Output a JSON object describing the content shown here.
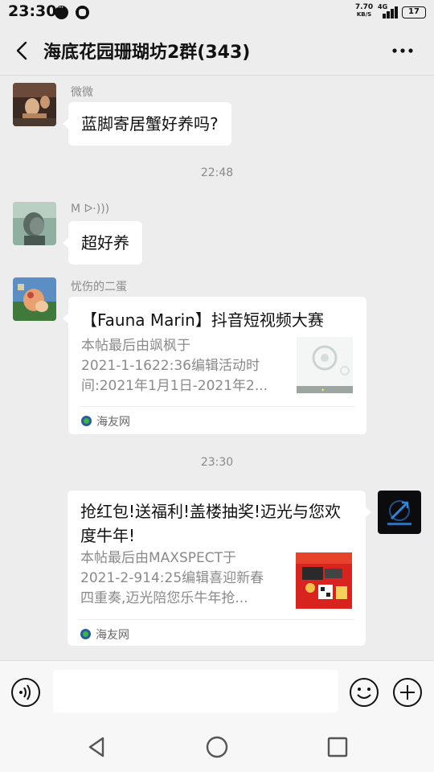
{
  "status_bar": {
    "time": "23:30",
    "net_speed_value": "7.70",
    "net_speed_unit": "KB/S",
    "network_type": "4G",
    "battery": "17"
  },
  "header": {
    "title": "海底花园珊瑚坊2群(343)",
    "back_icon": "chevron-left-icon",
    "more_icon": "more-dots-icon"
  },
  "messages": [
    {
      "type": "text",
      "side": "left",
      "sender": "微微",
      "text": "蓝脚寄居蟹好养吗?"
    },
    {
      "type": "time",
      "text": "22:48"
    },
    {
      "type": "text",
      "side": "left",
      "sender": "M ᐅ·)))",
      "text": "超好养"
    },
    {
      "type": "card",
      "side": "left",
      "sender": "忧伤的二蛋",
      "title": "【Fauna Marin】抖音短视频大赛",
      "desc_lines": [
        "本帖最后由飒枫于",
        "2021-1-1622:36编辑活动时",
        "间:2021年1月1日-2021年2..."
      ],
      "source": "海友网"
    },
    {
      "type": "time",
      "text": "23:30"
    },
    {
      "type": "card",
      "side": "right",
      "title": "抢红包!送福利!盖楼抽奖!迈光与您欢度牛年!",
      "desc_lines": [
        "本帖最后由MAXSPECT于",
        "2021-2-914:25编辑喜迎新春",
        "四重奏,迈光陪您乐牛年抢..."
      ],
      "source": "海友网"
    }
  ],
  "input_bar": {
    "voice_icon": "voice-icon",
    "placeholder": "",
    "emoji_icon": "emoji-icon",
    "plus_icon": "plus-icon"
  },
  "nav_bar": {
    "back_icon": "nav-back-icon",
    "home_icon": "nav-home-icon",
    "recent_icon": "nav-recent-icon"
  },
  "colors": {
    "background": "#ededed",
    "bubble": "#ffffff",
    "meta_text": "#8a8a8a"
  }
}
